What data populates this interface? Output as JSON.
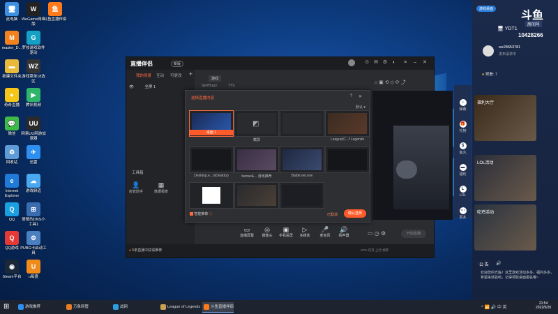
{
  "desktop": {
    "icons": [
      {
        "label": "此电脑",
        "icon": "computer-icon",
        "color": "#3d8fe0",
        "glyph": "🖥"
      },
      {
        "label": "WeGame网络版",
        "icon": "wegame-icon",
        "color": "#222",
        "glyph": "W"
      },
      {
        "label": "斗鱼直播伴侣",
        "icon": "douyu-icon",
        "color": "#ff7a1a",
        "glyph": "鱼"
      },
      {
        "label": "master_D...",
        "icon": "orange-app-icon",
        "color": "#f2821e",
        "glyph": "M"
      },
      {
        "label": "罗技游戏软件驱动",
        "icon": "logitech-icon",
        "color": "#15a1c4",
        "glyph": "G"
      },
      {
        "label": "新建文件夹",
        "icon": "folder-icon",
        "color": "#e8b93a",
        "glyph": "▬"
      },
      {
        "label": "游戏菜单18选区",
        "icon": "wz-icon",
        "color": "#333",
        "glyph": "WZ"
      },
      {
        "label": "奇奇直播",
        "icon": "chick-icon",
        "color": "#f5c518",
        "glyph": "●"
      },
      {
        "label": "腾讯视频",
        "icon": "tencent-video-icon",
        "color": "#2fb56a",
        "glyph": "▶"
      },
      {
        "label": "微信",
        "icon": "wechat-icon",
        "color": "#3fba46",
        "glyph": "💬"
      },
      {
        "label": "网易UU网游加速器",
        "icon": "uu-icon",
        "color": "#2a2a2a",
        "glyph": "UU"
      },
      {
        "label": "回收站",
        "icon": "recycle-bin-icon",
        "color": "#5f9bd6",
        "glyph": "♻"
      },
      {
        "label": "迅雷",
        "icon": "xunlei-icon",
        "color": "#2d8ff0",
        "glyph": "✈"
      },
      {
        "label": "Internet Explorer",
        "icon": "ie-icon",
        "color": "#1f7bd7",
        "glyph": "e"
      },
      {
        "label": "游戏频道",
        "icon": "cloud-icon",
        "color": "#4aa8f0",
        "glyph": "☁"
      },
      {
        "label": "QQ",
        "icon": "qq-icon",
        "color": "#1aa0e0",
        "glyph": "Q"
      },
      {
        "label": "傻傻的DNS小工具1",
        "icon": "network-icon",
        "color": "#3a6db0",
        "glyph": "⊞"
      },
      {
        "label": "QQ游戏",
        "icon": "qq-game-icon",
        "color": "#e53935",
        "glyph": "Q"
      },
      {
        "label": "PUBG卡启动工具",
        "icon": "tool-icon",
        "color": "#4a7fc0",
        "glyph": "⚙"
      },
      {
        "label": "Steam平台",
        "icon": "steam-icon",
        "color": "#1b2838",
        "glyph": "◉"
      },
      {
        "label": "u每盘",
        "icon": "u-app-icon",
        "color": "#f08a1a",
        "glyph": "U"
      }
    ]
  },
  "app": {
    "logo": "直播伴侣",
    "version": "新版",
    "tabs": [
      "我的场景",
      "互动",
      "可更改"
    ],
    "add_tab": "+",
    "scene_label": "全屏 1",
    "preview_tab": "游戏",
    "source_labels": [
      "Ser/Hrazz",
      "TTS"
    ],
    "tools_title": "工具箱",
    "tools": [
      {
        "label": "房管助手",
        "icon": "user-icon"
      },
      {
        "label": "数据报表",
        "icon": "report-icon"
      }
    ],
    "bottom_tools": [
      {
        "label": "直播屏幕",
        "icon": "screen-icon",
        "glyph": "▭"
      },
      {
        "label": "摄像头",
        "icon": "camera-icon",
        "glyph": "◎"
      },
      {
        "label": "手机投屏",
        "icon": "phone-cast-icon",
        "glyph": "▣"
      },
      {
        "label": "多媒体",
        "icon": "media-icon",
        "glyph": "▷"
      },
      {
        "label": "麦克风",
        "icon": "mic-icon",
        "glyph": "🎤"
      },
      {
        "label": "扬声器",
        "icon": "speaker-icon",
        "glyph": "🔊"
      }
    ],
    "start_button": "开始直播",
    "status_text": "5条直播中获得推荐",
    "status_right": [
      "CPU",
      "内存",
      "上行",
      "帧率"
    ]
  },
  "dialog": {
    "title": "选择直播内容",
    "filter": "默认",
    "sources": [
      {
        "label": "桌面 1",
        "selected": true,
        "theme": "desktop"
      },
      {
        "label": "截屏",
        "selected": false,
        "theme": "crop"
      },
      {
        "label": "",
        "selected": false,
        "theme": "empty"
      },
      {
        "label": "League(C...f Legends",
        "selected": false,
        "theme": "lol"
      },
      {
        "label": "Desktop.e...mDesktop",
        "selected": false,
        "theme": "dark"
      },
      {
        "label": "lwrnse&... 游戏推荐",
        "selected": false,
        "theme": "grid"
      },
      {
        "label": "Battle.net.exe",
        "selected": false,
        "theme": "battle"
      },
      {
        "label": "",
        "selected": false,
        "theme": "dark2"
      },
      {
        "label": "",
        "selected": false,
        "theme": "white"
      },
      {
        "label": "",
        "selected": false,
        "theme": "game"
      },
      {
        "label": "",
        "selected": false,
        "theme": "dark3"
      }
    ],
    "checkbox_label": "智能推荐",
    "cancel": "已取消",
    "confirm": "确认选择"
  },
  "chat": {
    "top_tag": "游戏桌面",
    "brand": "斗鱼",
    "brand_sub": "房间号",
    "room_label": "YDT1",
    "room_id": "10428266",
    "user_name": "wx28653781",
    "user_level": "发布请求中",
    "viewers_label": "观看: 7",
    "side_items": [
      {
        "label": "弹幕",
        "glyph": "♪"
      },
      {
        "label": "礼物",
        "glyph": "🎁"
      },
      {
        "label": "鱼丸",
        "glyph": "$"
      },
      {
        "label": "福利",
        "glyph": "▬"
      },
      {
        "label": "LOL",
        "glyph": "L"
      },
      {
        "label": "更多",
        "glyph": "⋯"
      }
    ],
    "cards": [
      {
        "title": "福利大厅",
        "sub": "",
        "color": "#3a2a1a"
      },
      {
        "title": "LOL活动",
        "sub": "",
        "color": "#2a2e3a"
      },
      {
        "title": "吃鸡活动",
        "sub": "",
        "color": "#2a3340"
      }
    ],
    "notice_title": "公 告",
    "notice_text": "欢迎您的光临！这里游戏活动多多，福利多多，希望来体验吧，记得领取桌面报名哦~"
  },
  "taskbar": {
    "start_icon": "windows-icon",
    "items": [
      {
        "label": "游戏推荐",
        "color": "#2d8ff0",
        "on": false
      },
      {
        "label": "万象网管",
        "color": "#e67e22",
        "on": false
      },
      {
        "label": "战网",
        "color": "#2aa0e0",
        "on": false
      },
      {
        "label": "League of Legends",
        "color": "#c8a250",
        "on": false
      },
      {
        "label": "斗鱼直播伴侣",
        "color": "#ff7a1a",
        "on": true
      }
    ],
    "time": "21:54",
    "date": "2022/5/26",
    "tray": [
      "^",
      "📶",
      "🔊",
      "中",
      "英"
    ]
  }
}
